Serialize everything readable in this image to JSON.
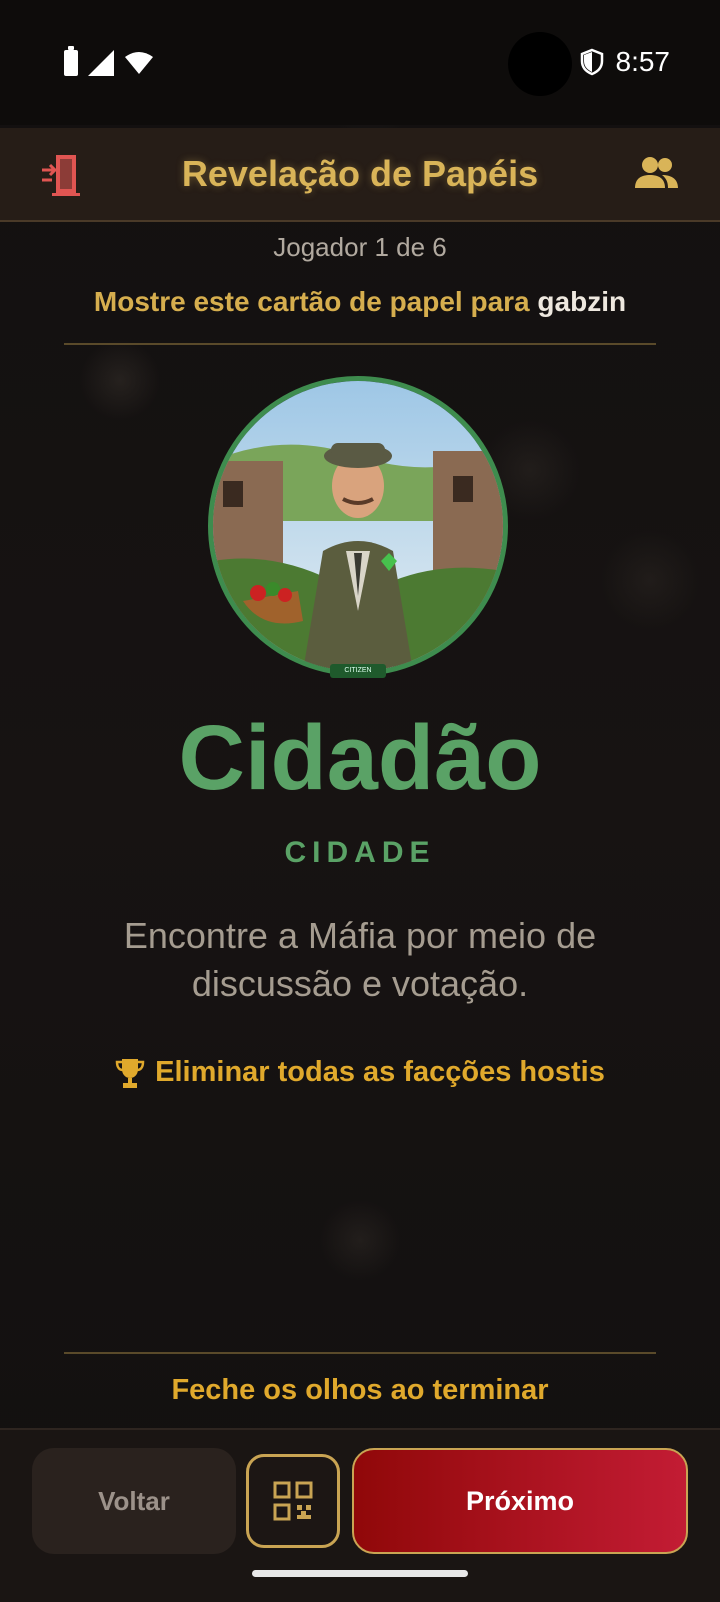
{
  "status_bar": {
    "time": "8:57",
    "icons": [
      "battery-icon",
      "signal-icon",
      "wifi-icon",
      "shield-icon"
    ]
  },
  "header": {
    "title": "Revelação de Papéis",
    "left_icon": "exit-door-icon",
    "right_icon": "players-group-icon"
  },
  "reveal": {
    "counter": "Jogador 1 de 6",
    "instruction_prefix": "Mostre este cartão de papel para ",
    "player_name": "gabzin"
  },
  "role": {
    "image_label": "CITIZEN",
    "name": "Cidadão",
    "faction": "CIDADE",
    "description": "Encontre a Máfia por meio de discussão e votação.",
    "goal": "Eliminar todas as facções hostis",
    "goal_icon": "trophy-icon"
  },
  "footer": {
    "close_eyes": "Feche os olhos ao terminar",
    "back_label": "Voltar",
    "qr_icon": "qr-code-icon",
    "next_label": "Próximo"
  },
  "colors": {
    "accent_gold": "#d9b458",
    "role_green": "#5aa266",
    "goal_amber": "#e0a92c",
    "next_red": "#b0142a"
  }
}
